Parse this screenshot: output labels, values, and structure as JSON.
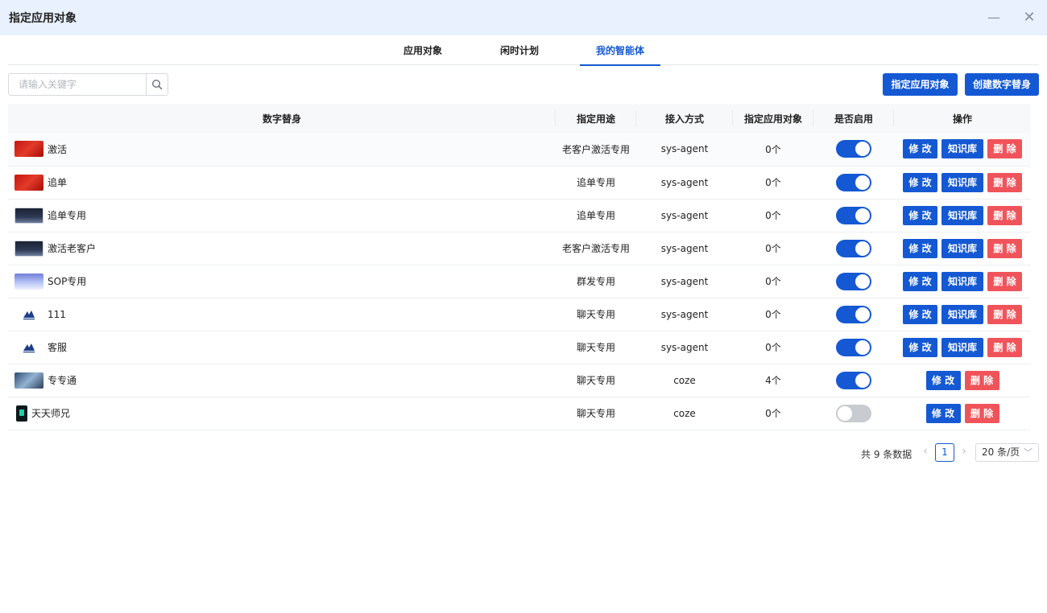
{
  "window": {
    "title": "指定应用对象",
    "minimize_glyph": "—",
    "close_glyph": "✕"
  },
  "tabs": [
    {
      "label": "应用对象"
    },
    {
      "label": "闲时计划"
    },
    {
      "label": "我的智能体",
      "active": true
    }
  ],
  "search": {
    "placeholder": "请输入关键字",
    "value": "",
    "icon": "search-icon"
  },
  "toolbar": {
    "assign_label": "指定应用对象",
    "create_label": "创建数字替身"
  },
  "table": {
    "headers": [
      "数字替身",
      "指定用途",
      "接入方式",
      "指定应用对象",
      "是否启用",
      "操作"
    ],
    "rows": [
      {
        "name": "激活",
        "thumb": "red",
        "purpose": "老客户激活专用",
        "access": "sys-agent",
        "targets": "0个",
        "enabled": true,
        "ops": [
          "修 改",
          "知识库",
          "删 除"
        ]
      },
      {
        "name": "追单",
        "thumb": "red",
        "purpose": "追单专用",
        "access": "sys-agent",
        "targets": "0个",
        "enabled": true,
        "ops": [
          "修 改",
          "知识库",
          "删 除"
        ]
      },
      {
        "name": "追单专用",
        "thumb": "dark",
        "purpose": "追单专用",
        "access": "sys-agent",
        "targets": "0个",
        "enabled": true,
        "ops": [
          "修 改",
          "知识库",
          "删 除"
        ]
      },
      {
        "name": "激活老客户",
        "thumb": "dark",
        "purpose": "老客户激活专用",
        "access": "sys-agent",
        "targets": "0个",
        "enabled": true,
        "ops": [
          "修 改",
          "知识库",
          "删 除"
        ]
      },
      {
        "name": "SOP专用",
        "thumb": "wave",
        "purpose": "群发专用",
        "access": "sys-agent",
        "targets": "0个",
        "enabled": true,
        "ops": [
          "修 改",
          "知识库",
          "删 除"
        ]
      },
      {
        "name": "111",
        "thumb": "logo",
        "purpose": "聊天专用",
        "access": "sys-agent",
        "targets": "0个",
        "enabled": true,
        "ops": [
          "修 改",
          "知识库",
          "删 除"
        ]
      },
      {
        "name": "客服",
        "thumb": "logo",
        "purpose": "聊天专用",
        "access": "sys-agent",
        "targets": "0个",
        "enabled": true,
        "ops": [
          "修 改",
          "知识库",
          "删 除"
        ]
      },
      {
        "name": "专专通",
        "thumb": "photo",
        "purpose": "聊天专用",
        "access": "coze",
        "targets": "4个",
        "enabled": true,
        "ops": [
          "修 改",
          "删 除"
        ]
      },
      {
        "name": "天天师兄",
        "thumb": "phone",
        "purpose": "聊天专用",
        "access": "coze",
        "targets": "0个",
        "enabled": false,
        "ops": [
          "修 改",
          "删 除"
        ]
      }
    ]
  },
  "pagination": {
    "total_text": "共 9 条数据",
    "current_page": "1",
    "page_size": "20 条/页",
    "prev_glyph": "‹",
    "next_glyph": "›",
    "size_chevron": "﹀"
  },
  "colors": {
    "primary": "#1459d3",
    "danger": "#f0545a",
    "titlebar_bg": "#e8f1fd"
  }
}
